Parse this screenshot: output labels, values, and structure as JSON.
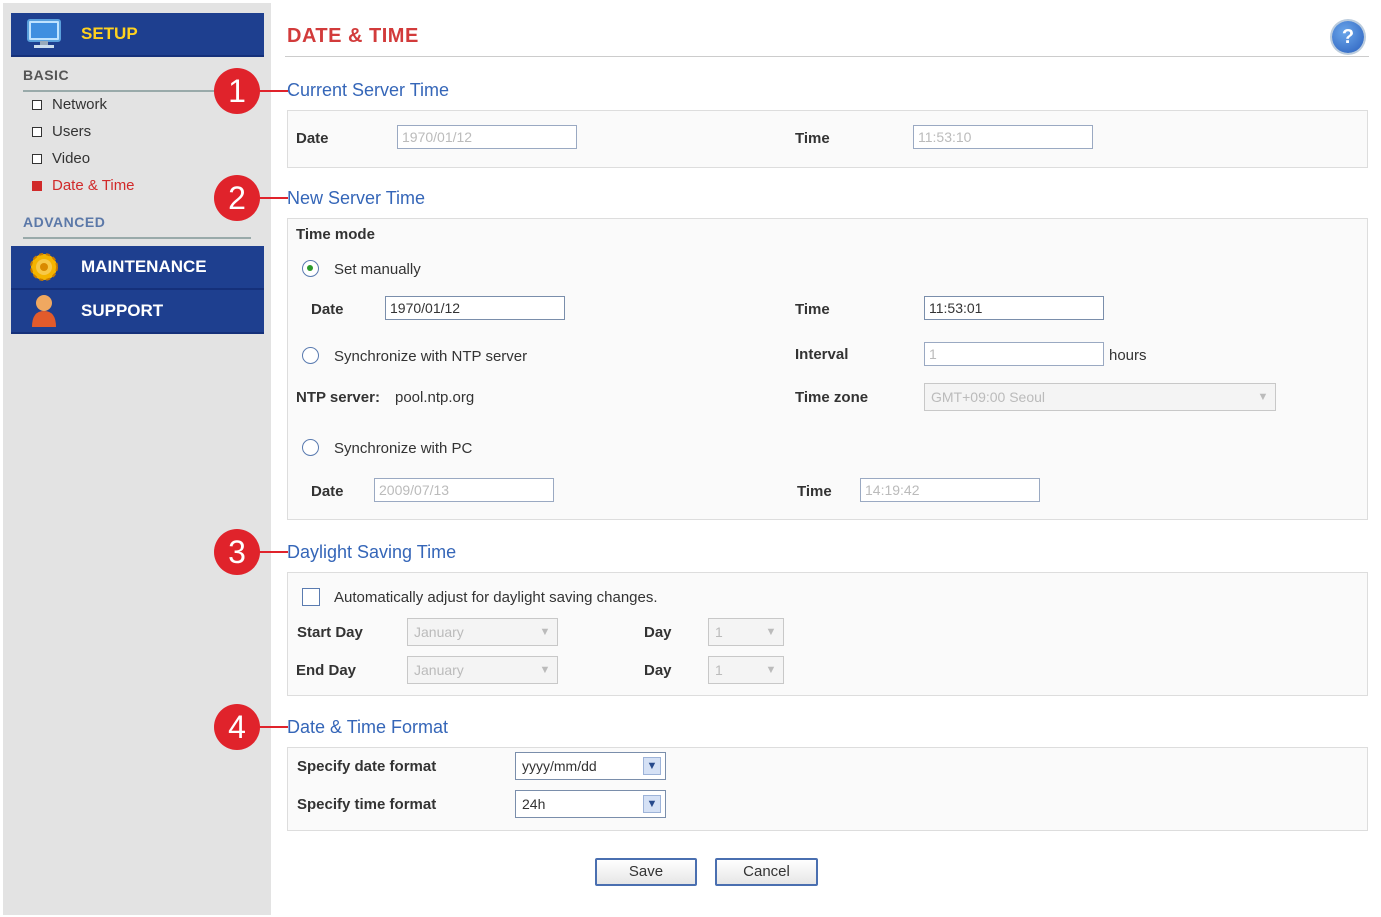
{
  "sidebar": {
    "setup": "SETUP",
    "basic_label": "BASIC",
    "items": [
      {
        "label": "Network"
      },
      {
        "label": "Users"
      },
      {
        "label": "Video"
      },
      {
        "label": "Date & Time"
      }
    ],
    "advanced_label": "ADVANCED",
    "maintenance": "MAINTENANCE",
    "support": "SUPPORT"
  },
  "page": {
    "title": "DATE & TIME",
    "help": "?"
  },
  "markers": [
    "1",
    "2",
    "3",
    "4"
  ],
  "current": {
    "heading": "Current Server Time",
    "date_label": "Date",
    "date_value": "1970/01/12",
    "time_label": "Time",
    "time_value": "11:53:10"
  },
  "new_time": {
    "heading": "New Server Time",
    "mode_label": "Time mode",
    "manual_label": "Set manually",
    "date_label": "Date",
    "date_value": "1970/01/12",
    "time_label": "Time",
    "time_value": "11:53:01",
    "ntp_label": "Synchronize with NTP server",
    "interval_label": "Interval",
    "interval_value": "1",
    "interval_unit": "hours",
    "ntp_server_label": "NTP server:",
    "ntp_server_value": "pool.ntp.org",
    "timezone_label": "Time zone",
    "timezone_value": "GMT+09:00 Seoul",
    "pc_label": "Synchronize with PC",
    "pc_date_label": "Date",
    "pc_date_value": "2009/07/13",
    "pc_time_label": "Time",
    "pc_time_value": "14:19:42"
  },
  "dst": {
    "heading": "Daylight Saving Time",
    "auto_label": "Automatically adjust for daylight saving changes.",
    "start_label": "Start Day",
    "start_month": "January",
    "start_day_label": "Day",
    "start_day": "1",
    "end_label": "End Day",
    "end_month": "January",
    "end_day_label": "Day",
    "end_day": "1"
  },
  "format": {
    "heading": "Date & Time Format",
    "date_format_label": "Specify date format",
    "date_format_value": "yyyy/mm/dd",
    "time_format_label": "Specify time format",
    "time_format_value": "24h"
  },
  "buttons": {
    "save": "Save",
    "cancel": "Cancel"
  },
  "colors": {
    "nav": "#1e3f8f",
    "title": "#d23b3b",
    "heading": "#3566b8",
    "marker": "#e0232b"
  }
}
